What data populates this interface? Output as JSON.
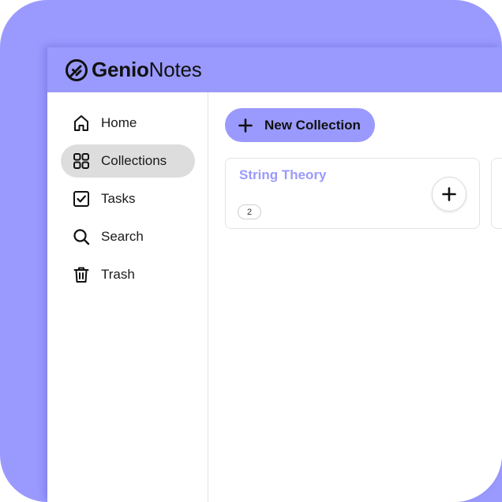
{
  "app": {
    "logo_icon": "compass-check-icon",
    "logo_bold": "Genio",
    "logo_light": "Notes"
  },
  "colors": {
    "accent": "#9a9afe",
    "active_nav": "#dddddd",
    "text": "#1a1a1a"
  },
  "sidebar": {
    "items": [
      {
        "label": "Home",
        "icon": "home-icon",
        "active": false
      },
      {
        "label": "Collections",
        "icon": "grid-icon",
        "active": true
      },
      {
        "label": "Tasks",
        "icon": "checkbox-icon",
        "active": false
      },
      {
        "label": "Search",
        "icon": "search-icon",
        "active": false
      },
      {
        "label": "Trash",
        "icon": "trash-icon",
        "active": false
      }
    ]
  },
  "toolbar": {
    "new_collection_label": "New Collection"
  },
  "collections": [
    {
      "title": "String Theory",
      "count": "2"
    }
  ]
}
